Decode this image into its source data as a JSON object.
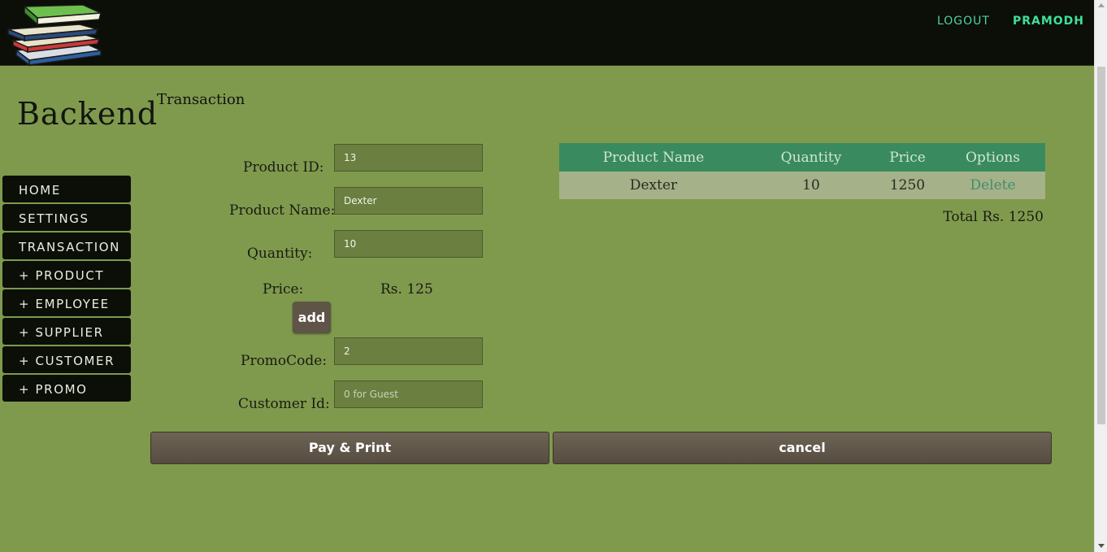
{
  "header": {
    "logo_icon": "books-stack-icon",
    "logout_label": "LOGOUT",
    "username": "PRAMODH",
    "colors": {
      "bar": "#0b0f08",
      "logout": "#4fd1a5",
      "user": "#3ee09a"
    }
  },
  "sidebar": {
    "title": "Backend",
    "items": [
      {
        "label": "HOME"
      },
      {
        "label": "SETTINGS"
      },
      {
        "label": "TRANSACTION"
      },
      {
        "label": "+ PRODUCT"
      },
      {
        "label": "+ EMPLOYEE"
      },
      {
        "label": "+ SUPPLIER"
      },
      {
        "label": "+ CUSTOMER"
      },
      {
        "label": "+ PROMO"
      }
    ]
  },
  "page": {
    "heading": "Transaction",
    "background": "#7f9a4d"
  },
  "form": {
    "product_id": {
      "label": "Product ID:",
      "value": "13"
    },
    "product_name": {
      "label": "Product Name:",
      "value": "Dexter"
    },
    "quantity": {
      "label": "Quantity:",
      "value": "10"
    },
    "price": {
      "label": "Price:",
      "value": "Rs. 125"
    },
    "add_label": "add",
    "promo_code": {
      "label": "PromoCode:",
      "value": "2"
    },
    "customer_id": {
      "label": "Customer Id:",
      "value": "",
      "placeholder": "0 for Guest"
    }
  },
  "cart": {
    "columns": [
      "Product Name",
      "Quantity",
      "Price",
      "Options"
    ],
    "rows": [
      {
        "name": "Dexter",
        "quantity": "10",
        "price": "1250",
        "option": "Delete"
      }
    ],
    "total": "Total Rs. 1250",
    "header_color": "#3a8a5f"
  },
  "actions": {
    "pay_label": "Pay & Print",
    "cancel_label": "cancel"
  }
}
